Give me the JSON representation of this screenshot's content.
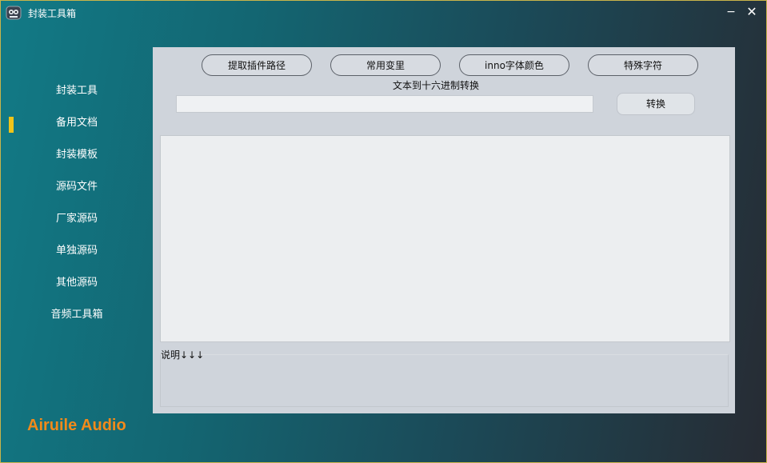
{
  "window": {
    "title": "封装工具箱",
    "minimize_glyph": "−",
    "close_glyph": "✕"
  },
  "sidebar": {
    "items": [
      {
        "label": "封装工具"
      },
      {
        "label": "备用文档"
      },
      {
        "label": "封装模板"
      },
      {
        "label": "源码文件"
      },
      {
        "label": "厂家源码"
      },
      {
        "label": "单独源码"
      },
      {
        "label": "其他源码"
      },
      {
        "label": "音频工具箱"
      }
    ],
    "selected": "备用文档",
    "marker_color": "#f0c419"
  },
  "brand": {
    "text": "Airuile Audio",
    "color": "#f28a1a"
  },
  "toolbar": {
    "buttons": [
      {
        "label": "提取插件路径"
      },
      {
        "label": "常用变里"
      },
      {
        "label": "inno字体颜色"
      },
      {
        "label": "特殊字符"
      }
    ]
  },
  "converter": {
    "label": "文本到十六进制转换",
    "input_value": "",
    "button_label": "转换"
  },
  "output": {
    "text": ""
  },
  "notes": {
    "label": "说明↓↓↓"
  }
}
